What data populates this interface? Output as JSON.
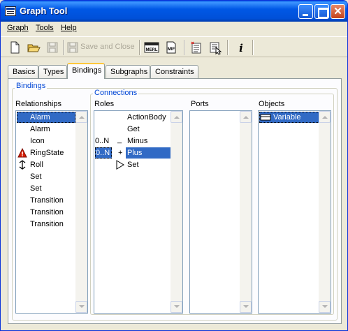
{
  "window": {
    "title": "Graph Tool"
  },
  "menu": [
    "Graph",
    "Tools",
    "Help"
  ],
  "toolbar": {
    "save_and_close_label": "Save and Close",
    "icons": [
      "new-icon",
      "open-icon",
      "save-icon",
      "save-and-close-icon",
      "meri-icon",
      "mif-icon",
      "list-icon",
      "select-icon",
      "info-icon"
    ]
  },
  "tabs": [
    "Basics",
    "Types",
    "Bindings",
    "Subgraphs",
    "Constraints"
  ],
  "active_tab": "Bindings",
  "bindings": {
    "group_label": "Bindings",
    "relationships_label": "Relationships",
    "relationships": [
      {
        "label": "Alarm",
        "selected": true
      },
      {
        "label": "Alarm"
      },
      {
        "label": "Icon"
      },
      {
        "label": "RingState",
        "icon": "warning-icon"
      },
      {
        "label": "Roll",
        "icon": "double-arrow-icon"
      },
      {
        "label": "Set"
      },
      {
        "label": "Set"
      },
      {
        "label": "Transition"
      },
      {
        "label": "Transition"
      },
      {
        "label": "Transition"
      }
    ],
    "connections": {
      "group_label": "Connections",
      "roles_label": "Roles",
      "ports_label": "Ports",
      "objects_label": "Objects",
      "roles": [
        {
          "card": "",
          "sym": "",
          "label": "ActionBody"
        },
        {
          "card": "",
          "sym": "",
          "label": "Get"
        },
        {
          "card": "0..N",
          "sym": "_",
          "label": "Minus"
        },
        {
          "card": "0..N",
          "sym": "+",
          "label": "Plus",
          "selected": true
        },
        {
          "card": "",
          "sym": "triangle",
          "label": "Set"
        }
      ],
      "ports": [],
      "objects": [
        {
          "label": "Variable",
          "icon": "variable-icon",
          "selected": true
        }
      ]
    }
  },
  "colors": {
    "selection": "#316ac5",
    "group_label": "#0046d5",
    "titlebar": "#0058e6"
  }
}
